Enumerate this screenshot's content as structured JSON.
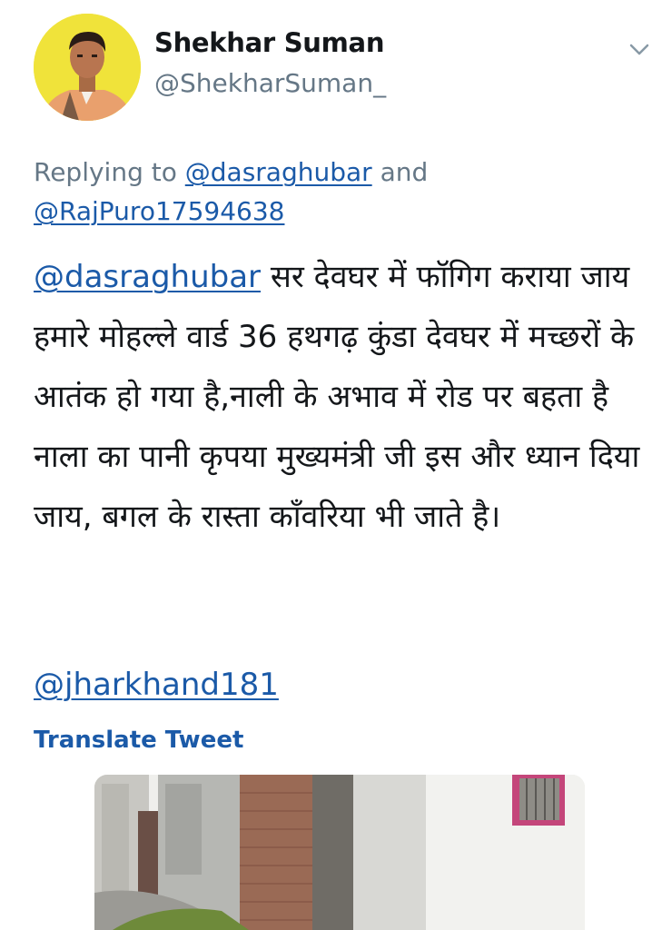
{
  "author": {
    "display_name": "Shekhar Suman",
    "handle": "@ShekharSuman_",
    "avatar_bg": "#f0e33a"
  },
  "reply": {
    "prefix": "Replying to ",
    "mention_1": "@dasraghubar",
    "connector": " and ",
    "mention_2": "@RajPuro17594638"
  },
  "tweet": {
    "mention": "@dasraghubar",
    "body": " सर देवघर में फॉगिग कराया जाय हमारे मोहल्ले वार्ड 36 हथगढ़ कुंडा देवघर में मच्छरों के आतंक हो गया है,नाली के अभाव में रोड पर बहता है नाला का पानी कृपया मुख्यमंत्री जी इस और ध्यान दिया जाय, बगल के रास्ता कॉंवरिया भी जाते है।",
    "trailing_mention": "@jharkhand181"
  },
  "actions": {
    "translate_label": "Translate Tweet",
    "menu_icon": "chevron-down-icon"
  },
  "colors": {
    "link": "#1b5aa8",
    "secondary_text": "#657786",
    "primary_text": "#14171a"
  }
}
